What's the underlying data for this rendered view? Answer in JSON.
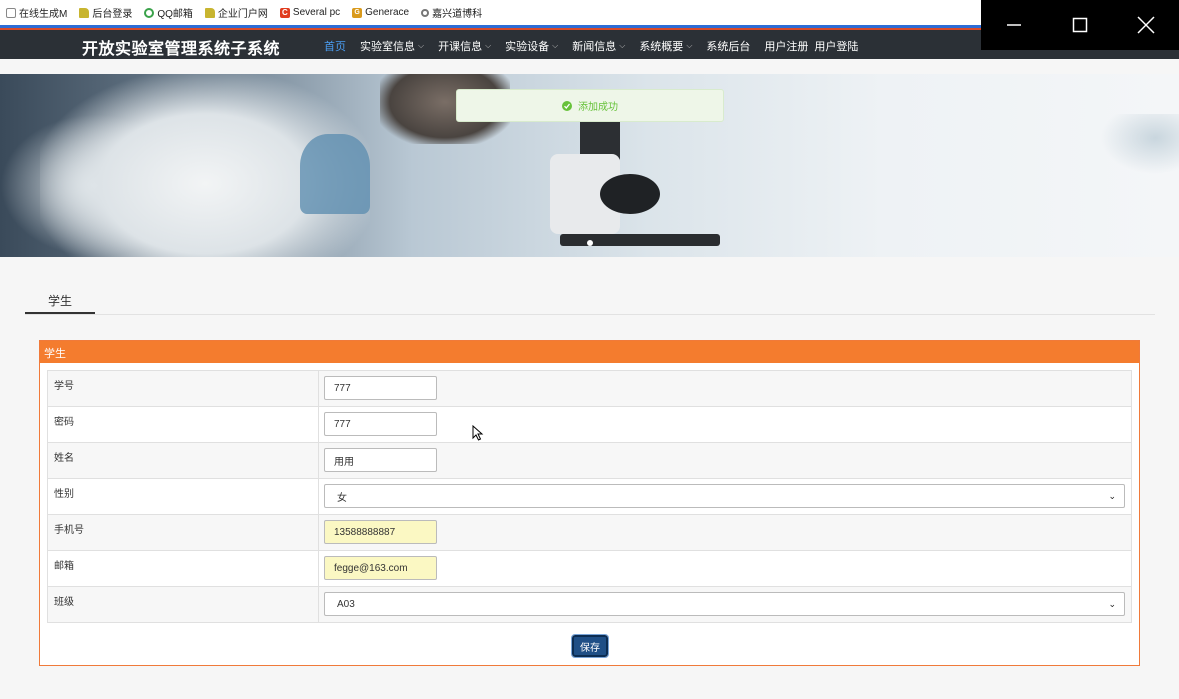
{
  "bookmarks": [
    {
      "label": "在线生成M",
      "icon": "doc-icon"
    },
    {
      "label": "后台登录",
      "icon": "folder-icon"
    },
    {
      "label": "QQ邮箱",
      "icon": "qq-icon"
    },
    {
      "label": "企业门户网",
      "icon": "folder-icon"
    },
    {
      "label": "Several pc",
      "icon": "red-c-icon"
    },
    {
      "label": "Generace",
      "icon": "gen-icon"
    },
    {
      "label": "嘉兴道博科",
      "icon": "gear-icon"
    }
  ],
  "navbar": {
    "brand": "开放实验室管理系统子系统",
    "items": [
      {
        "label": "首页",
        "active": true,
        "dropdown": false
      },
      {
        "label": "实验室信息",
        "active": false,
        "dropdown": true
      },
      {
        "label": "开课信息",
        "active": false,
        "dropdown": true
      },
      {
        "label": "实验设备",
        "active": false,
        "dropdown": true
      },
      {
        "label": "新闻信息",
        "active": false,
        "dropdown": true
      },
      {
        "label": "系统概要",
        "active": false,
        "dropdown": true
      },
      {
        "label": "系统后台",
        "active": false,
        "dropdown": false
      },
      {
        "label": "用户注册",
        "active": false,
        "dropdown": false
      },
      {
        "label": "用户登陆",
        "active": false,
        "dropdown": false
      }
    ]
  },
  "toast": {
    "message": "添加成功",
    "color": "#67c23a"
  },
  "tabs": [
    {
      "label": "学生"
    }
  ],
  "panel": {
    "title": "学生",
    "accent": "#f47c2e",
    "fields": [
      {
        "label": "学号",
        "type": "input",
        "value": "777",
        "autofill": false
      },
      {
        "label": "密码",
        "type": "input",
        "value": "777",
        "autofill": false
      },
      {
        "label": "姓名",
        "type": "input",
        "value": "用用",
        "autofill": false
      },
      {
        "label": "性别",
        "type": "select",
        "value": "女"
      },
      {
        "label": "手机号",
        "type": "input",
        "value": "13588888887",
        "autofill": true
      },
      {
        "label": "邮箱",
        "type": "input",
        "value": "fegge@163.com",
        "autofill": true
      },
      {
        "label": "班级",
        "type": "select",
        "value": "A03"
      }
    ],
    "save_label": "保存"
  }
}
